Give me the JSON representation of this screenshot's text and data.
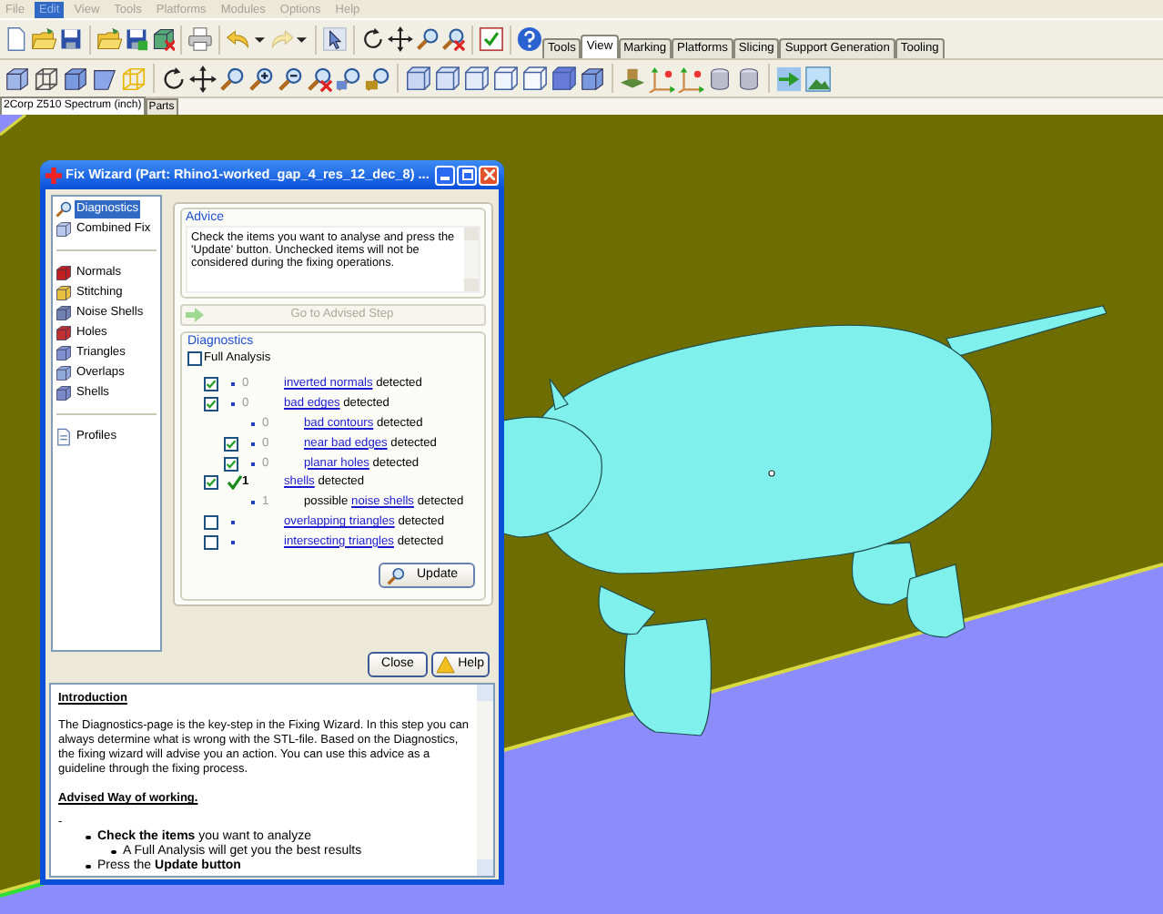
{
  "menu": [
    {
      "label": "File",
      "selected": false
    },
    {
      "label": "Edit",
      "selected": true
    },
    {
      "label": "View",
      "selected": false
    },
    {
      "label": "Tools",
      "selected": false
    },
    {
      "label": "Platforms",
      "selected": false
    },
    {
      "label": "Modules",
      "selected": false
    },
    {
      "label": "Options",
      "selected": false
    },
    {
      "label": "Help",
      "selected": false
    }
  ],
  "toolbar_tabs": [
    {
      "label": "Tools",
      "selected": false
    },
    {
      "label": "View",
      "selected": true
    },
    {
      "label": "Marking",
      "selected": false
    },
    {
      "label": "Platforms",
      "selected": false
    },
    {
      "label": "Slicing",
      "selected": false
    },
    {
      "label": "Support Generation",
      "selected": false
    },
    {
      "label": "Tooling",
      "selected": false
    }
  ],
  "document_tabs": [
    {
      "label": "2Corp Z510 Spectrum (inch)",
      "selected": true
    },
    {
      "label": "Parts",
      "selected": false
    }
  ],
  "dialog": {
    "title": "Fix Wizard (Part: Rhino1-worked_gap_4_res_12_dec_8) ...",
    "sidebar": {
      "groups": [
        {
          "items": [
            {
              "label": "Diagnostics",
              "selected": true
            },
            {
              "label": "Combined Fix",
              "selected": false
            }
          ]
        },
        {
          "items": [
            {
              "label": "Normals",
              "selected": false
            },
            {
              "label": "Stitching",
              "selected": false
            },
            {
              "label": "Noise Shells",
              "selected": false
            },
            {
              "label": "Holes",
              "selected": false
            },
            {
              "label": "Triangles",
              "selected": false
            },
            {
              "label": "Overlaps",
              "selected": false
            },
            {
              "label": "Shells",
              "selected": false
            }
          ]
        },
        {
          "items": [
            {
              "label": "Profiles",
              "selected": false
            }
          ]
        }
      ]
    },
    "advice": {
      "title": "Advice",
      "text": "Check the items you want to analyse and press the 'Update' button. Unchecked items will not be considered during the fixing operations."
    },
    "advised_step_button": {
      "label": "Go to Advised Step",
      "disabled": true
    },
    "diagnostics": {
      "title": "Diagnostics",
      "full_analysis": {
        "label": "Full Analysis",
        "checked": false
      },
      "rows": [
        {
          "checked": true,
          "passed": false,
          "value": "0",
          "link": "inverted normals",
          "suffix": " detected"
        },
        {
          "checked": true,
          "passed": false,
          "value": "0",
          "link": "bad edges",
          "suffix": " detected",
          "children": [
            {
              "passed": false,
              "value": "0",
              "link": "bad contours",
              "suffix": " detected"
            },
            {
              "checked": true,
              "passed": false,
              "value": "0",
              "link": "near bad edges",
              "suffix": " detected"
            },
            {
              "checked": true,
              "passed": false,
              "value": "0",
              "link": "planar holes",
              "suffix": " detected"
            }
          ]
        },
        {
          "checked": true,
          "passed": true,
          "value": "1",
          "link": "shells",
          "suffix": " detected",
          "children": [
            {
              "passed": false,
              "value": "1",
              "prefix": "possible ",
              "link": "noise shells",
              "suffix": " detected"
            }
          ]
        },
        {
          "checked": false,
          "passed": false,
          "link": "overlapping triangles",
          "suffix": " detected"
        },
        {
          "checked": false,
          "passed": false,
          "link": "intersecting triangles",
          "suffix": " detected"
        }
      ]
    },
    "update_button": "Update",
    "buttons": [
      "Close",
      "Help"
    ],
    "help": {
      "heading": "Introduction",
      "paragraph": "The Diagnostics-page is the key-step in the Fixing Wizard. In this step you can always determine what is wrong with the STL-file. Based on the Diagnostics, the fixing wizard will advise you an action. You can use this advice as a guideline through the fixing process.",
      "subheading": "Advised Way of working.",
      "dash": "-",
      "bullets": [
        {
          "text": "**Check the items** you want to analyze",
          "children": [
            {
              "text": "A Full Analysis will get you the best results"
            }
          ]
        },
        {
          "text": "Press the **Update button**"
        }
      ]
    }
  }
}
